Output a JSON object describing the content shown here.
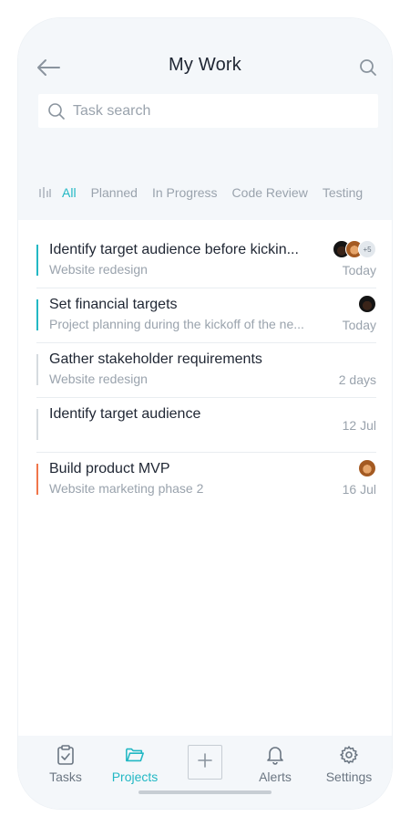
{
  "header": {
    "title": "My Work",
    "search_placeholder": "Task search"
  },
  "filters": [
    "All",
    "Planned",
    "In Progress",
    "Code Review",
    "Testing"
  ],
  "active_filter": "All",
  "tasks": [
    {
      "name": "Identify target audience before kickin...",
      "project": "Website redesign",
      "date": "Today",
      "accent": "#22b8c4",
      "avatars_more": "+5"
    },
    {
      "name": "Set financial targets",
      "project": "Project planning during the kickoff of the ne...",
      "date": "Today",
      "accent": "#22b8c4"
    },
    {
      "name": "Gather stakeholder requirements",
      "project": "Website redesign",
      "date": "2 days",
      "accent": "#d6dbe0"
    },
    {
      "name": "Identify target audience",
      "project": "",
      "date": "12 Jul",
      "accent": "#d6dbe0"
    },
    {
      "name": "Build product MVP",
      "project": "Website marketing phase 2",
      "date": "16 Jul",
      "accent": "#f0764a"
    }
  ],
  "tabbar": {
    "items": [
      {
        "label": "Tasks",
        "icon": "clipboard-check-icon"
      },
      {
        "label": "Projects",
        "icon": "folder-open-icon"
      },
      {
        "label": "Alerts",
        "icon": "bell-icon"
      },
      {
        "label": "Settings",
        "icon": "gear-icon"
      }
    ],
    "active": "Projects",
    "add_icon": "plus-icon"
  },
  "colors": {
    "accent": "#22b8c4",
    "muted": "#9aa3ad",
    "urgent": "#f0764a"
  }
}
